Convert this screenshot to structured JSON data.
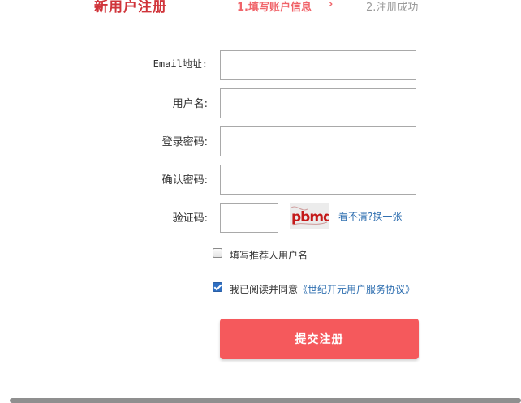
{
  "header": {
    "title": "新用户注册",
    "step1_label": "1.填写账户信息",
    "step_arrow": "›",
    "step2_label": "2.注册成功"
  },
  "form": {
    "email_label": "Email地址:",
    "email_value": "",
    "username_label": "用户名:",
    "username_value": "",
    "password_label": "登录密码:",
    "password_value": "",
    "confirm_label": "确认密码:",
    "confirm_value": "",
    "captcha_label": "验证码:",
    "captcha_value": "",
    "captcha_text": "pbmd",
    "refresh_link": "看不清?换一张"
  },
  "options": {
    "referrer_checked": false,
    "referrer_label": "填写推荐人用户名",
    "agree_checked": true,
    "agree_prefix": "我已阅读并同意",
    "agreement_link": "《世纪开元用户服务协议》"
  },
  "submit_label": "提交注册",
  "colors": {
    "accent": "#f5595c",
    "title": "#d0343a",
    "link": "#2f6fb0",
    "inactive_step": "#9a9a9a"
  }
}
